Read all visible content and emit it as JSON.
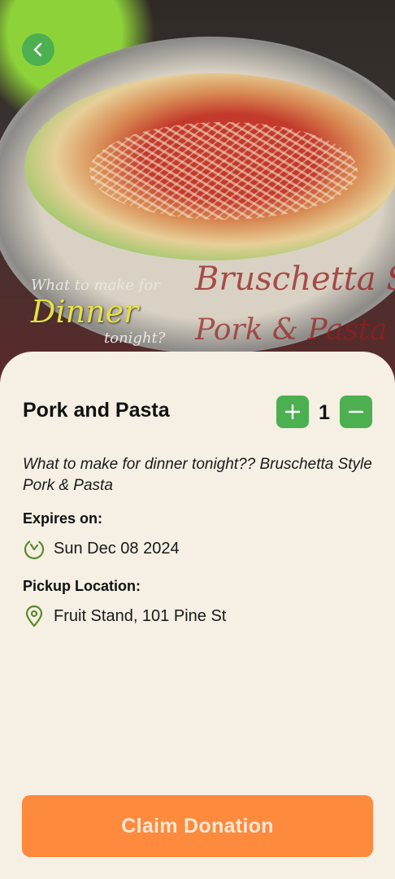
{
  "hero": {
    "watermark_line1": "What to make for",
    "watermark_line2": "Dinner",
    "watermark_line3": "tonight?",
    "watermark_right1": "Bruschetta Style",
    "watermark_right2": "Pork & Pasta"
  },
  "item": {
    "title": "Pork and Pasta",
    "quantity": "1",
    "description": "What to make for dinner tonight?? Bruschetta Style Pork & Pasta"
  },
  "expires": {
    "label": "Expires on:",
    "value": "Sun Dec 08 2024"
  },
  "pickup": {
    "label": "Pickup Location:",
    "value": "Fruit Stand, 101 Pine St"
  },
  "actions": {
    "claim_label": "Claim Donation"
  },
  "colors": {
    "accent_green": "#4caf50",
    "claim_orange": "#fe8a3d",
    "background": "#f5efe4"
  },
  "icons": {
    "back": "chevron-left-icon",
    "plus": "plus-icon",
    "minus": "minus-icon",
    "timer": "timer-icon",
    "location": "location-pin-icon"
  }
}
